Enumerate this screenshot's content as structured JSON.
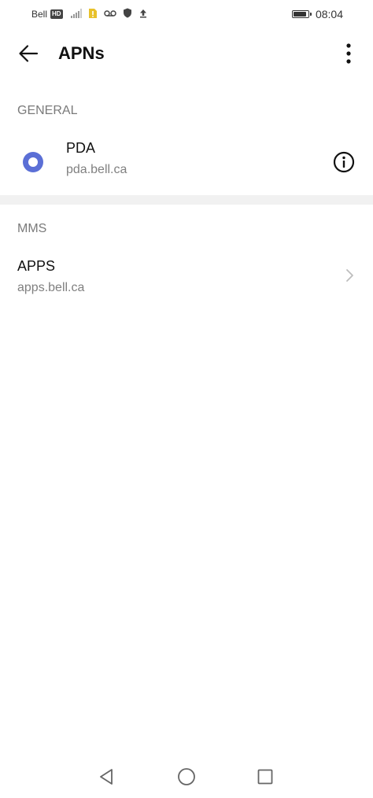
{
  "status_bar": {
    "carrier": "Bell",
    "network_badge": "HD",
    "time": "08:04",
    "battery_level": 0.9,
    "icons": [
      "signal-icon",
      "sim-alert-icon",
      "voicemail-icon",
      "shield-icon",
      "upload-icon",
      "battery-icon"
    ]
  },
  "app_bar": {
    "title": "APNs",
    "back_icon": "arrow-left-icon",
    "more_icon": "more-vert-icon"
  },
  "sections": [
    {
      "header": "GENERAL",
      "items": [
        {
          "name": "PDA",
          "apn": "pda.bell.ca",
          "selected": true,
          "trailing_icon": "info-icon"
        }
      ]
    },
    {
      "header": "MMS",
      "items": [
        {
          "name": "APPS",
          "apn": "apps.bell.ca",
          "selected": false,
          "trailing_icon": "chevron-right-icon"
        }
      ]
    }
  ],
  "nav_bar": {
    "icons": [
      "nav-back-icon",
      "nav-home-icon",
      "nav-recents-icon"
    ]
  },
  "colors": {
    "accent": "#5b6fd6",
    "section_header": "#7a7a7a",
    "subtitle": "#808080",
    "divider_band": "#f1f1f1"
  }
}
